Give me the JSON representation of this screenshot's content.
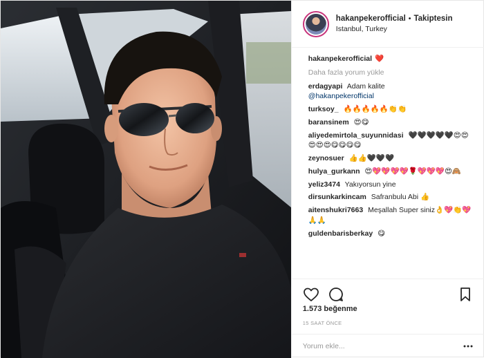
{
  "header": {
    "username": "hakanpekerofficial",
    "separator": "•",
    "follow_label": "Takiptesin",
    "location": "Istanbul, Turkey"
  },
  "caption": {
    "username": "hakanpekerofficial",
    "text": "❤️"
  },
  "load_more_label": "Daha fazla yorum yükle",
  "comments": [
    {
      "user": "erdagyapi",
      "text": "Adam kalite",
      "mention": "@hakanpekerofficial"
    },
    {
      "user": "turksoy_",
      "text": "🔥🔥🔥🔥🔥👏👏"
    },
    {
      "user": "baransinem",
      "text": "😍😋"
    },
    {
      "user": "aliyedemirtola_suyunnidasi",
      "text": "🖤🖤🖤🖤🖤😍😍😍😍😍😋😋😋😋"
    },
    {
      "user": "zeynosuer",
      "text": "👍👍🖤🖤🖤"
    },
    {
      "user": "hulya_gurkann",
      "text": "😍💖💖💖💖🌹💖💖💖😍🙈"
    },
    {
      "user": "yeliz3474",
      "text": "Yakıyorsun yine"
    },
    {
      "user": "dirsunkarkincam",
      "text": "Safranbulu Abi 👍"
    },
    {
      "user": "aitenshukri7663",
      "text": "Meşallah Super siniz👌💖👏💖🙏🙏"
    },
    {
      "user": "guldenbarisberkay",
      "text": "😋"
    }
  ],
  "likes_label": "1.573 beğenme",
  "time_label": "15 SAAT ÖNCE",
  "comment_input": {
    "placeholder": "Yorum ekle..."
  },
  "icons": {
    "like": "heart-icon",
    "comment": "comment-bubble-icon",
    "save": "bookmark-icon",
    "more": "more-dots-icon"
  }
}
